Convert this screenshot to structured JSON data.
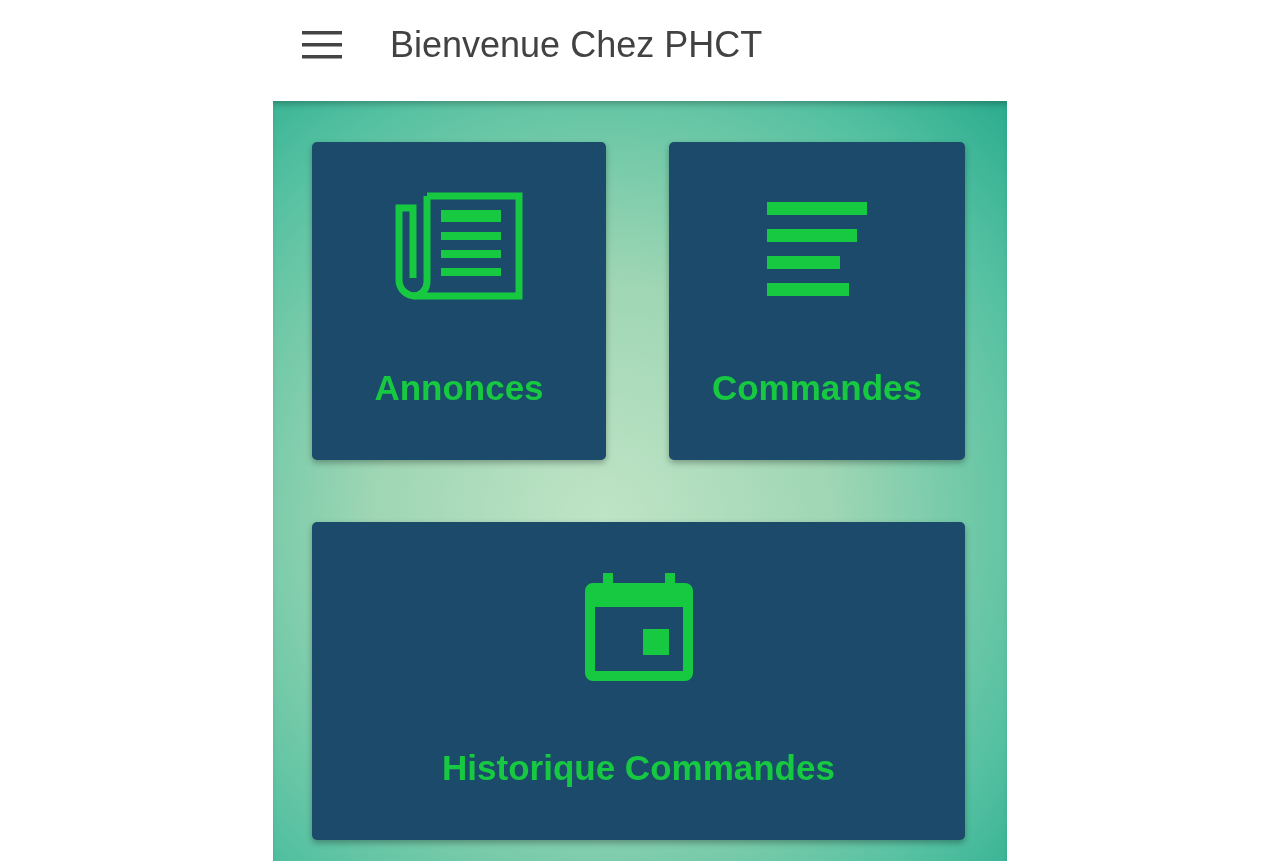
{
  "app_bar": {
    "title": "Bienvenue Chez PHCT"
  },
  "tiles": [
    {
      "label": "Annonces",
      "kind": "news"
    },
    {
      "label": "Commandes",
      "kind": "list"
    },
    {
      "label": "Historique Commandes",
      "kind": "calendar"
    }
  ]
}
